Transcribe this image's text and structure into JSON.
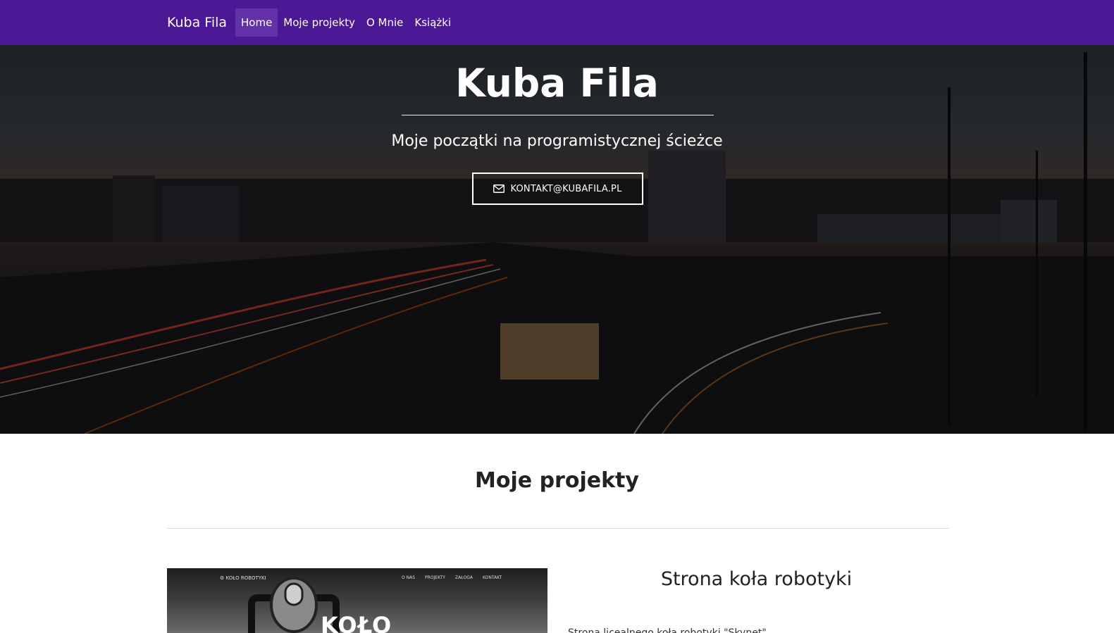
{
  "navbar": {
    "brand": "Kuba Fila",
    "items": [
      {
        "label": "Home",
        "active": true
      },
      {
        "label": "Moje projekty",
        "active": false
      },
      {
        "label": "O Mnie",
        "active": false
      },
      {
        "label": "Książki",
        "active": false
      }
    ],
    "color": "#4c1896"
  },
  "hero": {
    "title": "Kuba Fila",
    "subtitle": "Moje początki na programistycznej ścieżce",
    "contact_icon": "envelope-icon",
    "contact_label": "KONTAKT@KUBAFILA.PL"
  },
  "projects": {
    "section_title": "Moje projekty",
    "items": [
      {
        "title": "Strona koła robotyki",
        "description": "Strona licealnego koła robotyki \"Skynet\"",
        "thumbnail": {
          "logo_text": "⚙ KOŁO ROBOTYKI",
          "menu": [
            "O NAS",
            "PROJEKTY",
            "ZAŁOGA",
            "KONTAKT"
          ],
          "big_text": "KOŁO"
        }
      }
    ]
  }
}
